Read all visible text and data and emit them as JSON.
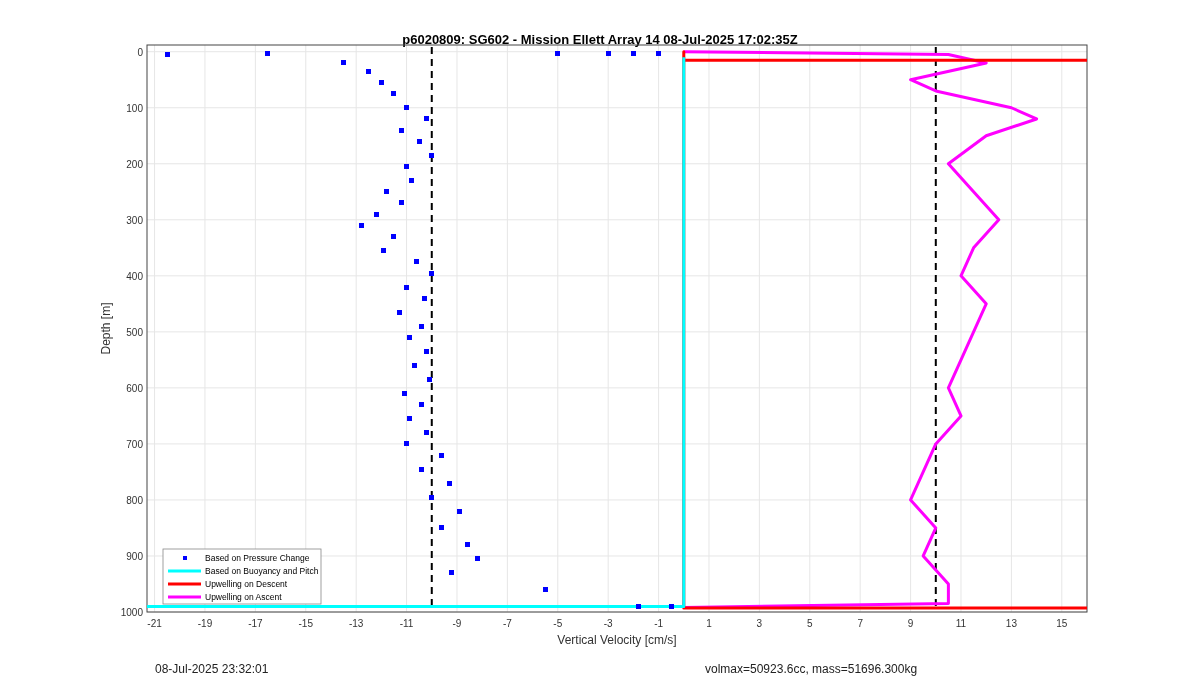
{
  "figure": {
    "chart_data": {
      "type": "scatter",
      "title": "p6020809: SG602 - Mission Ellett Array 14 08-Jul-2025 17:02:35Z",
      "xlabel": "Vertical Velocity [cm/s]",
      "ylabel": "Depth [m]",
      "xlim": [
        -21.3,
        16
      ],
      "ylim": [
        1000,
        -12
      ],
      "xticks": [
        -21,
        -19,
        -17,
        -15,
        -13,
        -11,
        -9,
        -7,
        -5,
        -3,
        -1,
        1,
        3,
        5,
        7,
        9,
        11,
        13,
        15
      ],
      "yticks": [
        0,
        100,
        200,
        300,
        400,
        500,
        600,
        700,
        800,
        900,
        1000
      ],
      "series": [
        {
          "name": "Based on Pressure Change",
          "type": "scatter",
          "color": "#0000ff",
          "x": [
            -20.5,
            -16.5,
            -5,
            -3,
            -2,
            -1,
            -13.5,
            -12.5,
            -12,
            -11.5,
            -11,
            -10.2,
            -11.2,
            -10.5,
            -10,
            -11,
            -10.8,
            -11.8,
            -11.2,
            -12.2,
            -12.8,
            -11.5,
            -11.9,
            -10.6,
            -10,
            -11,
            -10.3,
            -11.3,
            -10.4,
            -10.9,
            -10.2,
            -10.7,
            -10.1,
            -11.1,
            -10.4,
            -10.9,
            -10.2,
            -11,
            -9.6,
            -10.4,
            -9.3,
            -10,
            -8.9,
            -9.6,
            -8.6,
            -8.2,
            -9.2,
            -5.5,
            -1.8,
            -0.5
          ],
          "values": [
            5,
            3,
            3,
            3,
            3,
            3,
            20,
            35,
            55,
            75,
            100,
            120,
            140,
            160,
            185,
            205,
            230,
            250,
            270,
            290,
            310,
            330,
            355,
            375,
            395,
            420,
            440,
            465,
            490,
            510,
            535,
            560,
            585,
            610,
            630,
            655,
            680,
            700,
            720,
            745,
            770,
            795,
            820,
            850,
            880,
            905,
            930,
            960,
            990,
            990
          ]
        },
        {
          "name": "Based on Buoyancy and Pitch",
          "type": "line",
          "color": "#00ffff",
          "x": [
            -21.3,
            0,
            0
          ],
          "values": [
            990,
            990,
            10
          ]
        },
        {
          "name": "Upwelling on Descent",
          "type": "line",
          "color": "#ff0000",
          "x": [
            16,
            0,
            0,
            0,
            16
          ],
          "values": [
            15,
            15,
            0,
            993,
            993
          ]
        },
        {
          "name": "Upwelling on Ascent",
          "type": "line",
          "color": "#ff00ff",
          "x": [
            0,
            10.5,
            12,
            9,
            10,
            13,
            14,
            12,
            10.5,
            11.5,
            12.5,
            11.5,
            11,
            12,
            11.5,
            11,
            10.5,
            11,
            10,
            9.5,
            9,
            10,
            9.5,
            10.5,
            10.5,
            0
          ],
          "values": [
            0,
            5,
            20,
            50,
            70,
            100,
            120,
            150,
            200,
            250,
            300,
            350,
            400,
            450,
            500,
            550,
            600,
            650,
            700,
            750,
            800,
            850,
            900,
            950,
            985,
            992
          ]
        }
      ],
      "ref_lines": [
        {
          "axis": "x",
          "value": -10
        },
        {
          "axis": "x",
          "value": 10
        }
      ],
      "grid": true,
      "legend": true
    }
  },
  "footer": {
    "timestamp": "08-Jul-2025 23:32:01",
    "info": "volmax=50923.6cc, mass=51696.300kg"
  }
}
